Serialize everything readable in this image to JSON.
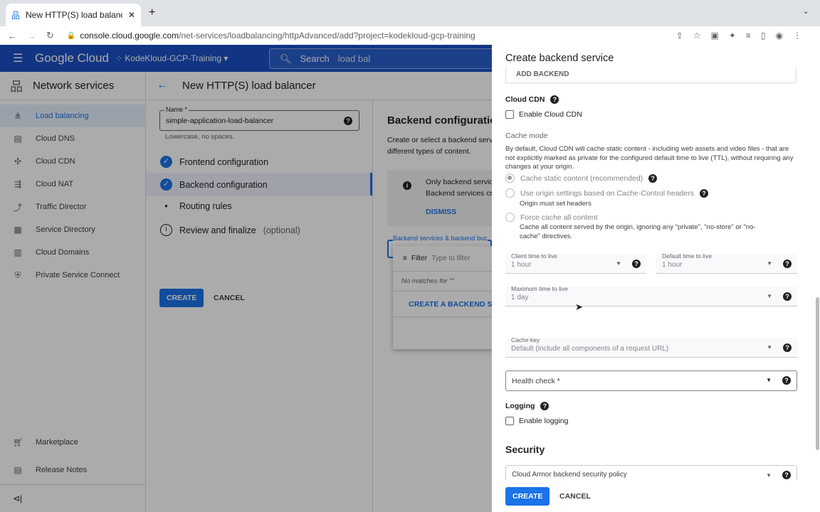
{
  "browser": {
    "tab_title": "New HTTP(S) load balancer – l",
    "url_host": "console.cloud.google.com",
    "url_path": "/net-services/loadbalancing/httpAdvanced/add?project=kodekloud-gcp-training"
  },
  "header": {
    "logo": "Google Cloud",
    "project": "KodeKloud-GCP-Training",
    "search_label": "Search",
    "search_value": "load bal"
  },
  "sidebar": {
    "title": "Network services",
    "items": [
      "Load balancing",
      "Cloud DNS",
      "Cloud CDN",
      "Cloud NAT",
      "Traffic Director",
      "Service Directory",
      "Cloud Domains",
      "Private Service Connect"
    ],
    "bottom": [
      "Marketplace",
      "Release Notes"
    ]
  },
  "main": {
    "title": "New HTTP(S) load balancer",
    "name_label": "Name *",
    "name_value": "simple-application-load-balancer",
    "name_hint": "Lowercase, no spaces.",
    "steps": [
      "Frontend configuration",
      "Backend configuration",
      "Routing rules",
      "Review and finalize"
    ],
    "optional": "(optional)",
    "create": "CREATE",
    "cancel": "CANCEL",
    "backend": {
      "title": "Backend configuration",
      "desc1": "Create or select a backend servi",
      "desc2": "different types of content.",
      "info1": "Only backend servic",
      "info2": "Backend services cr",
      "dismiss": "DISMISS",
      "field_label": "Backend services & backend buc",
      "filter": "Filter",
      "filter_placeholder": "Type to filter",
      "no_matches": "No matches for \"\"",
      "create_backend": "CREATE A BACKEND SER"
    }
  },
  "panel": {
    "title": "Create backend service",
    "add_backend": "ADD BACKEND",
    "cdn_label": "Cloud CDN",
    "enable_cdn": "Enable Cloud CDN",
    "cache_mode": "Cache mode",
    "cache_desc": "By default, Cloud CDN will cache static content - including web assets and video files - that are not explicitly marked as private for the configured default time to live (TTL), without requiring any changes at your origin.",
    "options": [
      {
        "label": "Cache static content (recommended)",
        "sub": ""
      },
      {
        "label": "Use origin settings based on Cache-Control headers",
        "sub": "Origin must set headers"
      },
      {
        "label": "Force cache all content",
        "sub": "Cache all content served by the origin, ignoring any \"private\", \"no-store\" or \"no-cache\" directives."
      }
    ],
    "client_ttl_label": "Client time to live",
    "client_ttl": "1 hour",
    "default_ttl_label": "Default time to live",
    "default_ttl": "1 hour",
    "max_ttl_label": "Maximum time to live",
    "max_ttl": "1 day",
    "cache_key_label": "Cache key",
    "cache_key": "Default (include all components of a request URL)",
    "health_check": "Health check *",
    "logging": "Logging",
    "enable_logging": "Enable logging",
    "security": "Security",
    "armor": "Cloud Armor backend security policy",
    "create": "CREATE",
    "cancel": "CANCEL"
  }
}
